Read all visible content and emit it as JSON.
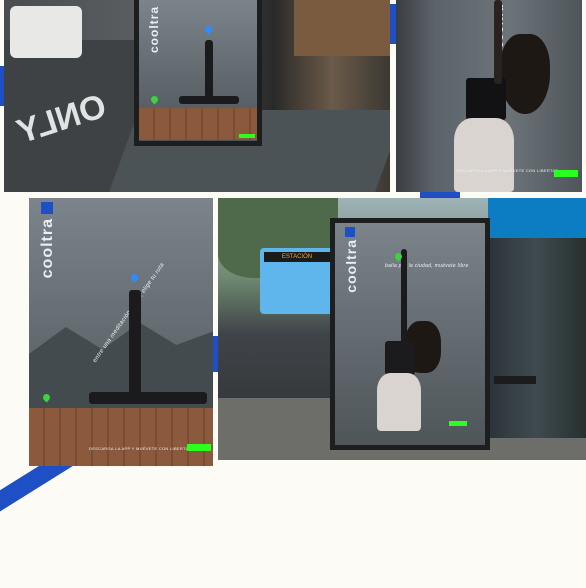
{
  "brand": {
    "logo_text": "cooltra",
    "accent_color": "#1f4fc4",
    "highlight_color": "#2bff1f"
  },
  "poster_copy": {
    "handwritten_yoga": "entre una meditación y otra, elige tu ruta",
    "handwritten_dance": "baila por la ciudad, muévete libre",
    "footer": "DESCARGA LA APP Y MUÉVETE CON LIBERTAD"
  },
  "scene": {
    "street_marking": "ONLY",
    "bus_display": "ESTACIÓN"
  },
  "icons": [
    "location-pin-icon",
    "location-pin-icon"
  ]
}
